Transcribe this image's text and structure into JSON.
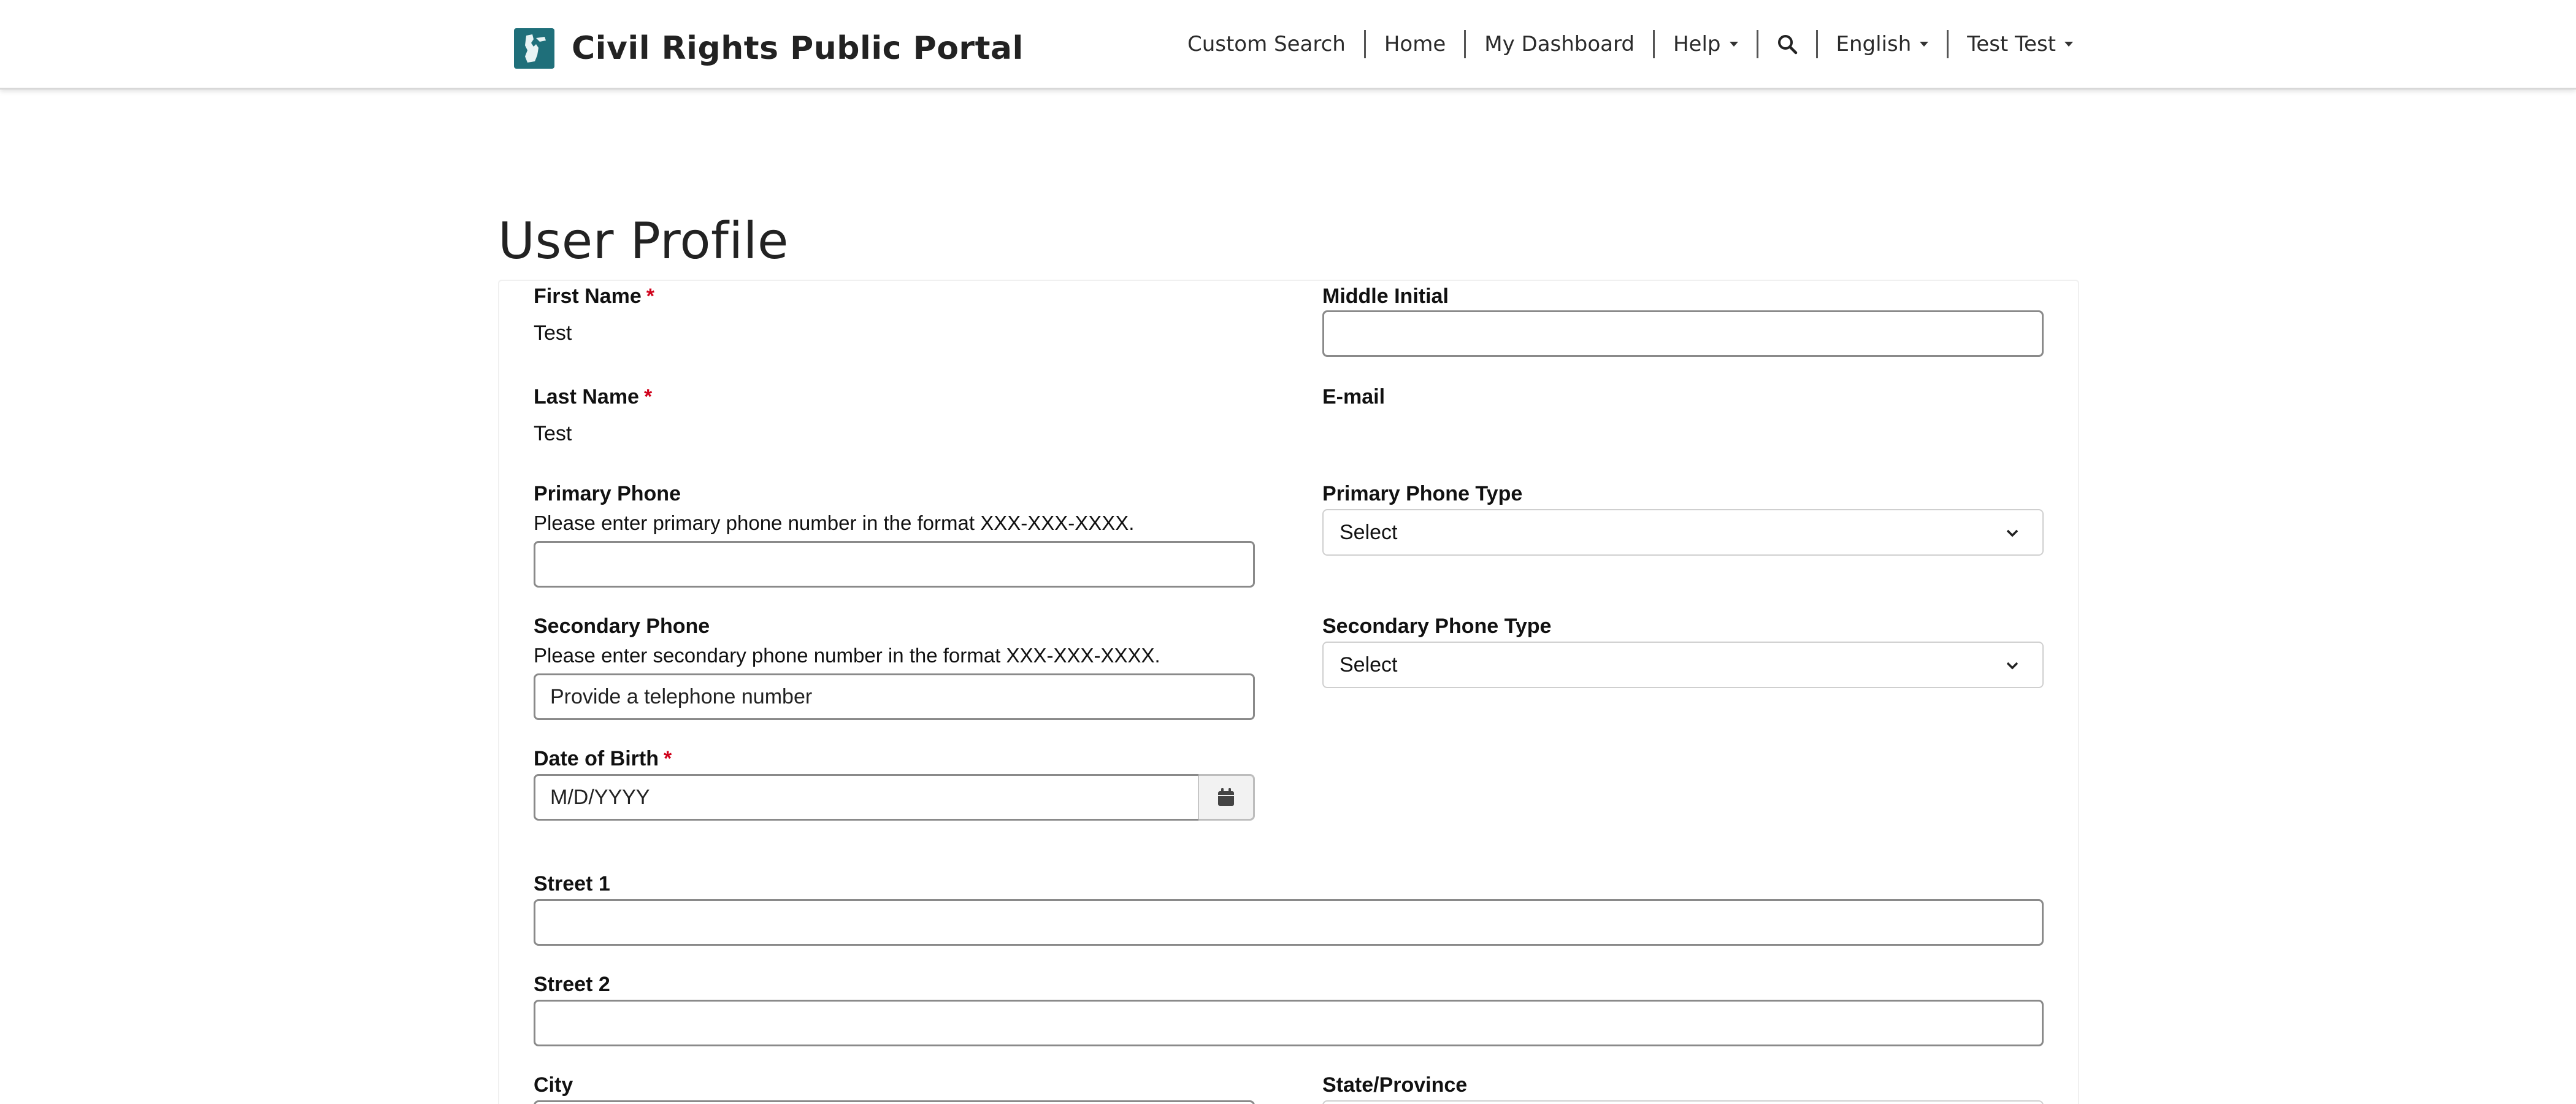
{
  "header": {
    "title": "Civil Rights Public Portal",
    "nav": [
      {
        "label": "Custom Search"
      },
      {
        "label": "Home"
      },
      {
        "label": "My Dashboard"
      },
      {
        "label": "Help",
        "dropdown": true
      },
      {
        "icon": "search-icon"
      },
      {
        "label": "English",
        "dropdown": true
      },
      {
        "label": "Test Test",
        "dropdown": true
      }
    ]
  },
  "page": {
    "title": "User Profile"
  },
  "form": {
    "first_name": {
      "label": "First Name",
      "required_mark": "*",
      "value": "Test"
    },
    "middle_initial": {
      "label": "Middle Initial",
      "value": ""
    },
    "last_name": {
      "label": "Last Name",
      "required_mark": "*",
      "value": "Test"
    },
    "email": {
      "label": "E-mail",
      "value": ""
    },
    "primary_phone": {
      "label": "Primary Phone",
      "hint": "Please enter primary phone number in the format XXX-XXX-XXXX.",
      "value": ""
    },
    "primary_phone_type": {
      "label": "Primary Phone Type",
      "selected": "Select"
    },
    "secondary_phone": {
      "label": "Secondary Phone",
      "hint": "Please enter secondary phone number in the format XXX-XXX-XXXX.",
      "placeholder": "Provide a telephone number"
    },
    "secondary_phone_type": {
      "label": "Secondary Phone Type",
      "selected": "Select"
    },
    "date_of_birth": {
      "label": "Date of Birth",
      "required_mark": "*",
      "placeholder": "M/D/YYYY"
    },
    "street1": {
      "label": "Street 1",
      "value": ""
    },
    "street2": {
      "label": "Street 2",
      "value": ""
    },
    "city": {
      "label": "City"
    },
    "state": {
      "label": "State/Province"
    }
  },
  "colors": {
    "accent_logo": "#1f6f7a",
    "required": "#d0021b"
  }
}
